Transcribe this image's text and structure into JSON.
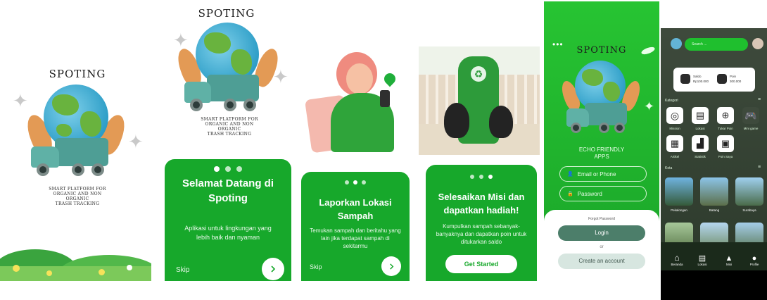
{
  "screens": {
    "splash": {
      "brand": "SPOTING",
      "tagline": [
        "SMART PLATFORM FOR",
        "ORGANIC AND NON ORGANIC",
        "TRASH TRACKING"
      ]
    },
    "onboarding1": {
      "brand": "SPOTING",
      "tagline": [
        "SMART PLATFORM FOR",
        "ORGANIC AND NON ORGANIC",
        "TRASH TRACKING"
      ],
      "title": "Selamat Datang di Spoting",
      "body": "Aplikasi untuk lingkungan yang lebih baik dan  nyaman",
      "skip": "Skip",
      "next_icon": "chevron-right-icon",
      "active_dot": 0
    },
    "onboarding2": {
      "title": "Laporkan Lokasi Sampah",
      "body": "Temukan sampah dan beritahu yang lain jika terdapat sampah di sekitarmu",
      "skip": "Skip",
      "next_icon": "chevron-right-icon",
      "active_dot": 1
    },
    "onboarding3": {
      "title": "Selesaikan Misi dan dapatkan hadiah!",
      "body": "Kumpulkan sampah sebanyak-banyaknya dan dapatkan poin untuk ditukarkan saldo",
      "cta": "Get Started",
      "active_dot": 2
    },
    "login": {
      "brand": "SPOTING",
      "app_name": "ECHO FRIENDLY APPS",
      "email_placeholder": "Email or Phone",
      "password_placeholder": "Password",
      "forgot": "Forgot Password",
      "login_button": "Login",
      "or": "or",
      "create_button": "Create an account",
      "menu_icon": "more-horizontal-icon"
    },
    "home": {
      "search_placeholder": "Search ...",
      "balance": [
        {
          "label": "Saldo",
          "value": "Rp100.000"
        },
        {
          "label": "Poin",
          "value": "300.000"
        }
      ],
      "categories_title": "Kategori",
      "categories": [
        {
          "label": "Mission",
          "icon": "target-icon"
        },
        {
          "label": "Lokasi",
          "icon": "map-icon"
        },
        {
          "label": "Tukar Poin",
          "icon": "coin-icon"
        },
        {
          "label": "Mini game",
          "icon": "gamepad-icon"
        },
        {
          "label": "Artikel",
          "icon": "newspaper-icon"
        },
        {
          "label": "Statistik",
          "icon": "chart-icon"
        },
        {
          "label": "Poin Saya",
          "icon": "wallet-icon"
        }
      ],
      "places_title": "Kota",
      "places": [
        "Pekalongan",
        "Batang",
        "Surabaya"
      ],
      "nav": [
        {
          "label": "Beranda",
          "icon": "home-icon"
        },
        {
          "label": "Lokasi",
          "icon": "map-icon"
        },
        {
          "label": "Misi",
          "icon": "bag-icon"
        },
        {
          "label": "Profile",
          "icon": "user-icon"
        }
      ]
    }
  }
}
